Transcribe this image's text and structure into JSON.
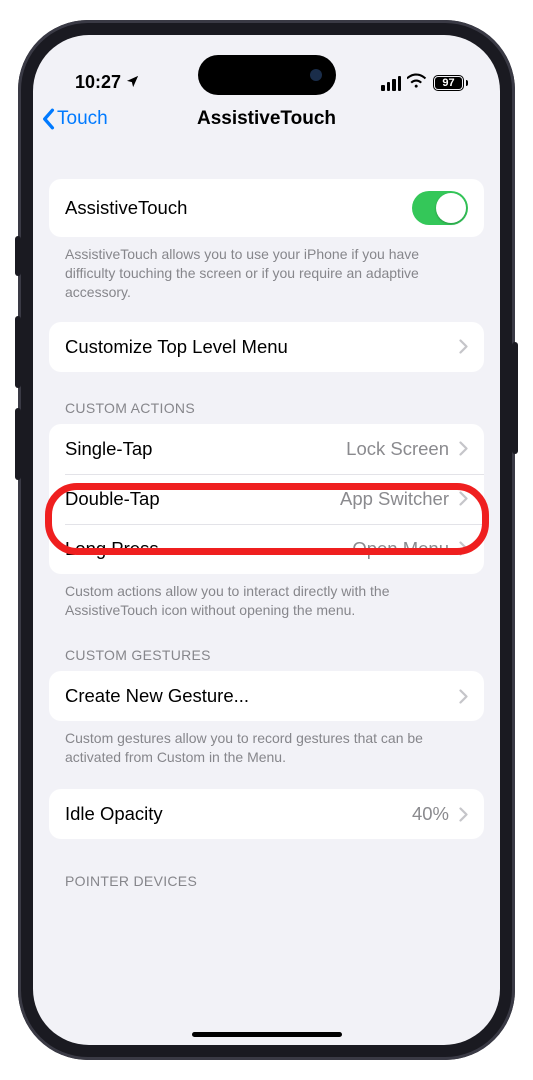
{
  "status": {
    "time": "10:27",
    "battery_pct": "97"
  },
  "nav": {
    "back_label": "Touch",
    "title": "AssistiveTouch"
  },
  "main_toggle": {
    "label": "AssistiveTouch",
    "on": true,
    "description": "AssistiveTouch allows you to use your iPhone if you have difficulty touching the screen or if you require an adaptive accessory."
  },
  "customize_menu": {
    "label": "Customize Top Level Menu"
  },
  "custom_actions": {
    "header": "CUSTOM ACTIONS",
    "rows": [
      {
        "label": "Single-Tap",
        "value": "Lock Screen"
      },
      {
        "label": "Double-Tap",
        "value": "App Switcher"
      },
      {
        "label": "Long Press",
        "value": "Open Menu"
      }
    ],
    "footer": "Custom actions allow you to interact directly with the AssistiveTouch icon without opening the menu."
  },
  "custom_gestures": {
    "header": "CUSTOM GESTURES",
    "label": "Create New Gesture...",
    "footer": "Custom gestures allow you to record gestures that can be activated from Custom in the Menu."
  },
  "idle_opacity": {
    "label": "Idle Opacity",
    "value": "40%"
  },
  "pointer_devices": {
    "header": "POINTER DEVICES"
  },
  "highlight": {
    "target": "single-tap-row"
  }
}
